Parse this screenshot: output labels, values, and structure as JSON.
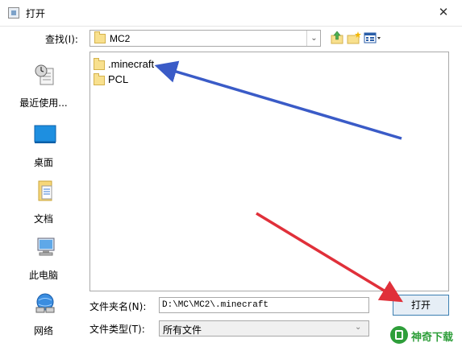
{
  "window": {
    "title": "打开",
    "close_glyph": "✕"
  },
  "toolbar": {
    "look_in_label": "查找(I):",
    "look_in_value": "MC2",
    "up_icon": "up-folder-icon",
    "new_folder_icon": "new-folder-icon",
    "view_icon": "view-menu-icon"
  },
  "places": [
    {
      "label": "最近使用...",
      "icon": "recent-items-icon"
    },
    {
      "label": "桌面",
      "icon": "desktop-icon"
    },
    {
      "label": "文档",
      "icon": "documents-icon"
    },
    {
      "label": "此电脑",
      "icon": "computer-icon"
    },
    {
      "label": "网络",
      "icon": "network-icon"
    }
  ],
  "files": [
    {
      "name": ".minecraft",
      "icon": "folder-icon"
    },
    {
      "name": "PCL",
      "icon": "folder-icon"
    }
  ],
  "footer": {
    "filename_label": "文件夹名(N):",
    "filename_value": "D:\\MC\\MC2\\.minecraft",
    "filetype_label": "文件类型(T):",
    "filetype_value": "所有文件",
    "open_label": "打开"
  },
  "watermark": {
    "text": "神奇下载"
  },
  "colors": {
    "blue_arrow": "#3a5bc7",
    "red_arrow": "#e0303a",
    "accent": "#3c7fb1"
  }
}
